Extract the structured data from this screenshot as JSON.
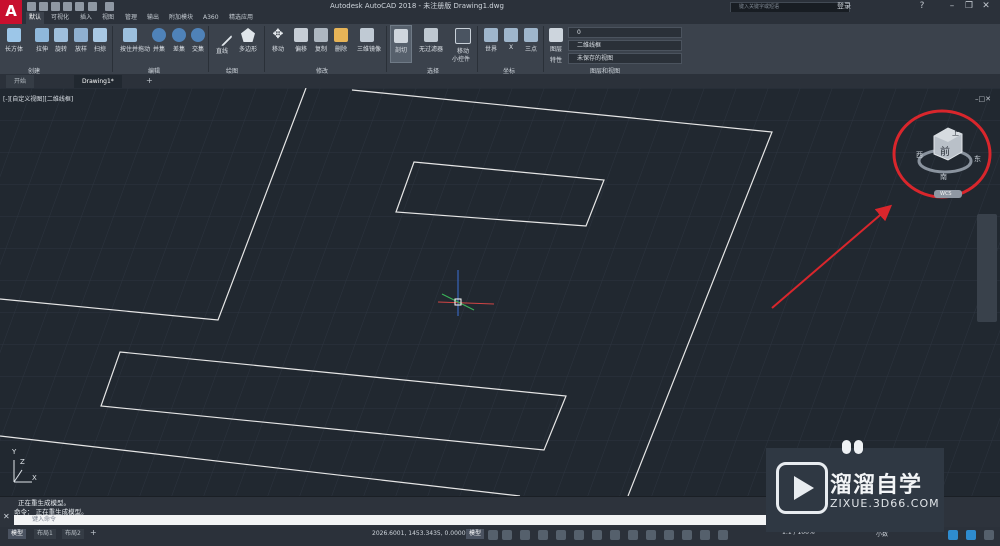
{
  "titlebar": {
    "logo_letter": "A",
    "title": "Autodesk AutoCAD 2018 - 未注册版    Drawing1.dwg",
    "search_placeholder": "键入关键字或短语",
    "login": "登录",
    "help": "?"
  },
  "ribbon_tabs": [
    "默认",
    "可视化",
    "插入",
    "视图",
    "管理",
    "输出",
    "附加模块",
    "A360",
    "精选应用"
  ],
  "ribbon_tools": [
    "长方体",
    "拉伸",
    "旋转",
    "放样",
    "扫掠",
    "按住并拖动",
    "并集",
    "差集",
    "交集",
    "直线",
    "多边形",
    "移动",
    "偏移",
    "复制",
    "删除",
    "三维镜像",
    "剖切",
    "无过滤器",
    "移动",
    "小控件",
    "世界",
    "X",
    "三点",
    "图层",
    "特性"
  ],
  "ribbon_panels": [
    "创建",
    "编辑",
    "绘图",
    "修改",
    "选择",
    "坐标",
    "图层和视图"
  ],
  "layer": {
    "current_layer": "0",
    "visual_style": "二维线框",
    "saved_view": "未保存的视图"
  },
  "doc_tabs": [
    "开始",
    "Drawing1*"
  ],
  "viewport": {
    "label": "[-][自定义视图][二维线框]",
    "viewcube_top": "上",
    "viewcube_front": "前",
    "viewcube_south": "南",
    "viewcube_east": "东",
    "viewcube_west": "西",
    "wcs": "WCS",
    "ucs_x": "X",
    "ucs_y": "Y",
    "ucs_z": "Z"
  },
  "command": {
    "line1": "正在重生成模型。",
    "line2": "命令：   正在重生成模型。",
    "placeholder": "键入命令"
  },
  "status": {
    "layout_tabs": [
      "模型",
      "布局1",
      "布局2"
    ],
    "coords": "2026.6001, 1453.3435, 0.0000",
    "model": "模型",
    "scale": "1:1 / 100%",
    "units": "小数"
  },
  "watermark": {
    "brand_cn": "溜溜自学",
    "brand_url": "ZIXUE.3D66.COM"
  },
  "colors": {
    "viewport_bg": "#212830",
    "line_color": "#e6e6e6",
    "annotation_red": "#d9262c",
    "accent_blue": "#2e8ccf"
  }
}
